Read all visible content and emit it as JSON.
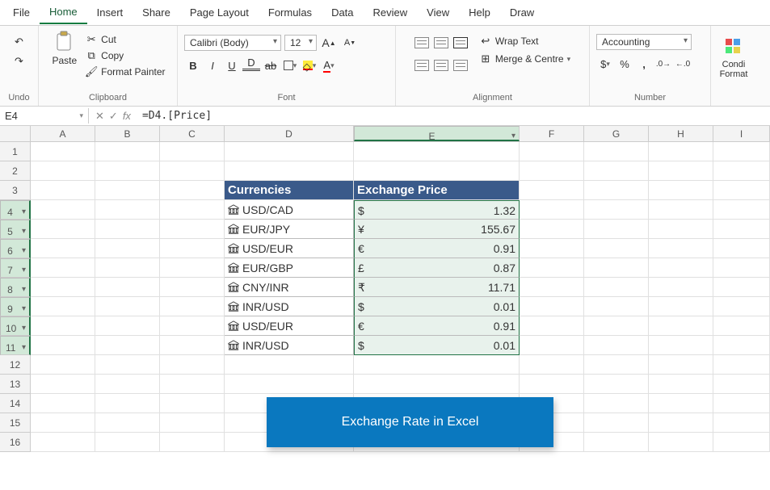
{
  "tabs": [
    "File",
    "Home",
    "Insert",
    "Share",
    "Page Layout",
    "Formulas",
    "Data",
    "Review",
    "View",
    "Help",
    "Draw"
  ],
  "activeTab": "Home",
  "ribbon": {
    "undo": {
      "label": "Undo"
    },
    "clipboard": {
      "label": "Clipboard",
      "paste": "Paste",
      "cut": "Cut",
      "copy": "Copy",
      "fp": "Format Painter"
    },
    "font": {
      "label": "Font",
      "name": "Calibri (Body)",
      "size": "12"
    },
    "alignment": {
      "label": "Alignment",
      "wrap": "Wrap Text",
      "merge": "Merge & Centre"
    },
    "number": {
      "label": "Number",
      "format": "Accounting"
    },
    "cond": {
      "l1": "Condi",
      "l2": "Format"
    }
  },
  "nameBox": "E4",
  "formula": "=D4.[Price]",
  "columns": [
    "A",
    "B",
    "C",
    "D",
    "E",
    "F",
    "G",
    "H",
    "I"
  ],
  "tableHeader": {
    "d": "Currencies",
    "e": "Exchange Price"
  },
  "rowsData": [
    {
      "cur": "USD/CAD",
      "sym": "$",
      "val": "1.32"
    },
    {
      "cur": "EUR/JPY",
      "sym": "¥",
      "val": "155.67"
    },
    {
      "cur": "USD/EUR",
      "sym": "€",
      "val": "0.91"
    },
    {
      "cur": "EUR/GBP",
      "sym": "£",
      "val": "0.87"
    },
    {
      "cur": "CNY/INR",
      "sym": "₹",
      "val": "11.71"
    },
    {
      "cur": "INR/USD",
      "sym": "$",
      "val": "0.01"
    },
    {
      "cur": "USD/EUR",
      "sym": "€",
      "val": "0.91"
    },
    {
      "cur": "INR/USD",
      "sym": "$",
      "val": "0.01"
    }
  ],
  "banner": "Exchange Rate in Excel",
  "chart_data": {
    "type": "table",
    "title": "Exchange Rate in Excel",
    "columns": [
      "Currencies",
      "Exchange Price"
    ],
    "rows": [
      [
        "USD/CAD",
        1.32
      ],
      [
        "EUR/JPY",
        155.67
      ],
      [
        "USD/EUR",
        0.91
      ],
      [
        "EUR/GBP",
        0.87
      ],
      [
        "CNY/INR",
        11.71
      ],
      [
        "INR/USD",
        0.01
      ],
      [
        "USD/EUR",
        0.91
      ],
      [
        "INR/USD",
        0.01
      ]
    ]
  }
}
